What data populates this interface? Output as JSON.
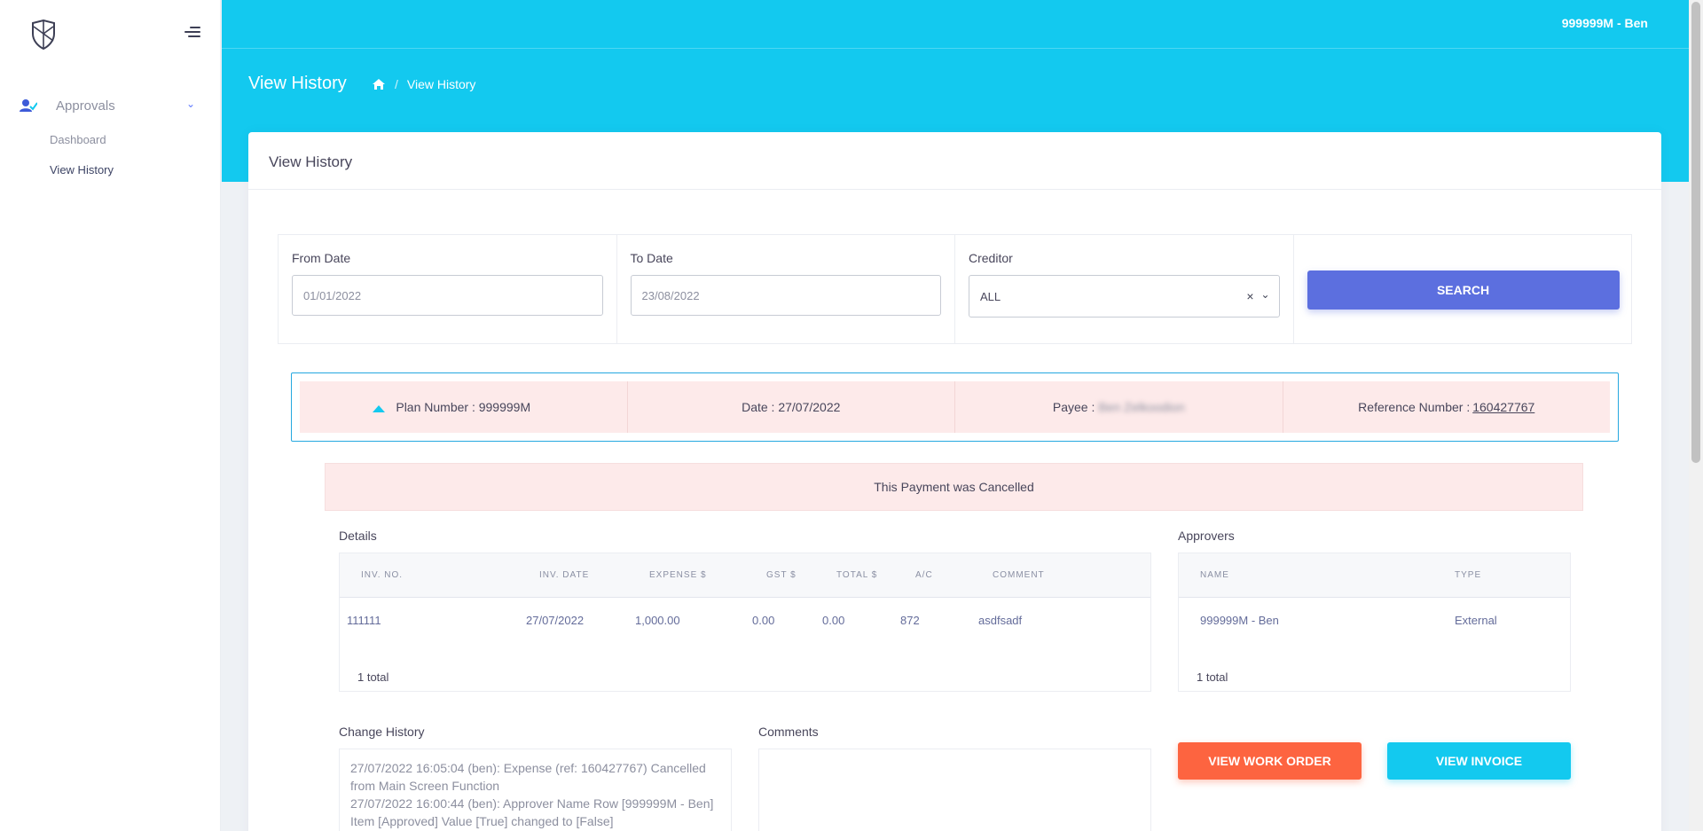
{
  "user": {
    "name": "999999M - Ben"
  },
  "sidebar": {
    "group": {
      "label": "Approvals"
    },
    "items": [
      {
        "label": "Dashboard"
      },
      {
        "label": "View History"
      }
    ]
  },
  "header": {
    "title": "View History",
    "breadcrumb": "View History"
  },
  "card": {
    "title": "View History"
  },
  "filters": {
    "from_label": "From Date",
    "from_value": "01/01/2022",
    "to_label": "To Date",
    "to_value": "23/08/2022",
    "creditor_label": "Creditor",
    "creditor_value": "ALL",
    "search_label": "SEARCH"
  },
  "plan": {
    "plan_label": "Plan Number : 999999M",
    "date_label": "Date : 27/07/2022",
    "payee_label": "Payee :",
    "payee_value": "Ben Zelkoodion",
    "ref_label": "Reference Number :",
    "ref_value": "160427767"
  },
  "status": {
    "message": "This Payment was Cancelled"
  },
  "details": {
    "title": "Details",
    "columns": [
      "INV. NO.",
      "INV. DATE",
      "EXPENSE $",
      "GST $",
      "TOTAL $",
      "A/C",
      "COMMENT"
    ],
    "rows": [
      {
        "inv_no": "111111",
        "inv_date": "27/07/2022",
        "expense": "1,000.00",
        "gst": "0.00",
        "total": "0.00",
        "ac": "872",
        "comment": "asdfsadf"
      }
    ],
    "total": "1 total"
  },
  "approvers": {
    "title": "Approvers",
    "columns": [
      "NAME",
      "TYPE"
    ],
    "rows": [
      {
        "name": "999999M - Ben",
        "type": "External"
      }
    ],
    "total": "1 total"
  },
  "change_history": {
    "title": "Change History",
    "entries": [
      "27/07/2022 16:05:04 (ben): Expense (ref: 160427767) Cancelled from Main Screen Function",
      "27/07/2022 16:00:44 (ben): Approver Name Row [999999M - Ben] Item [Approved] Value [True] changed to [False]"
    ]
  },
  "comments": {
    "title": "Comments"
  },
  "actions": {
    "work_order": "VIEW WORK ORDER",
    "invoice": "VIEW INVOICE"
  },
  "colors": {
    "accent": "#13c9ef",
    "primary": "#5c6fdf",
    "danger": "#fd6440",
    "alert_bg": "#fdeaea"
  }
}
